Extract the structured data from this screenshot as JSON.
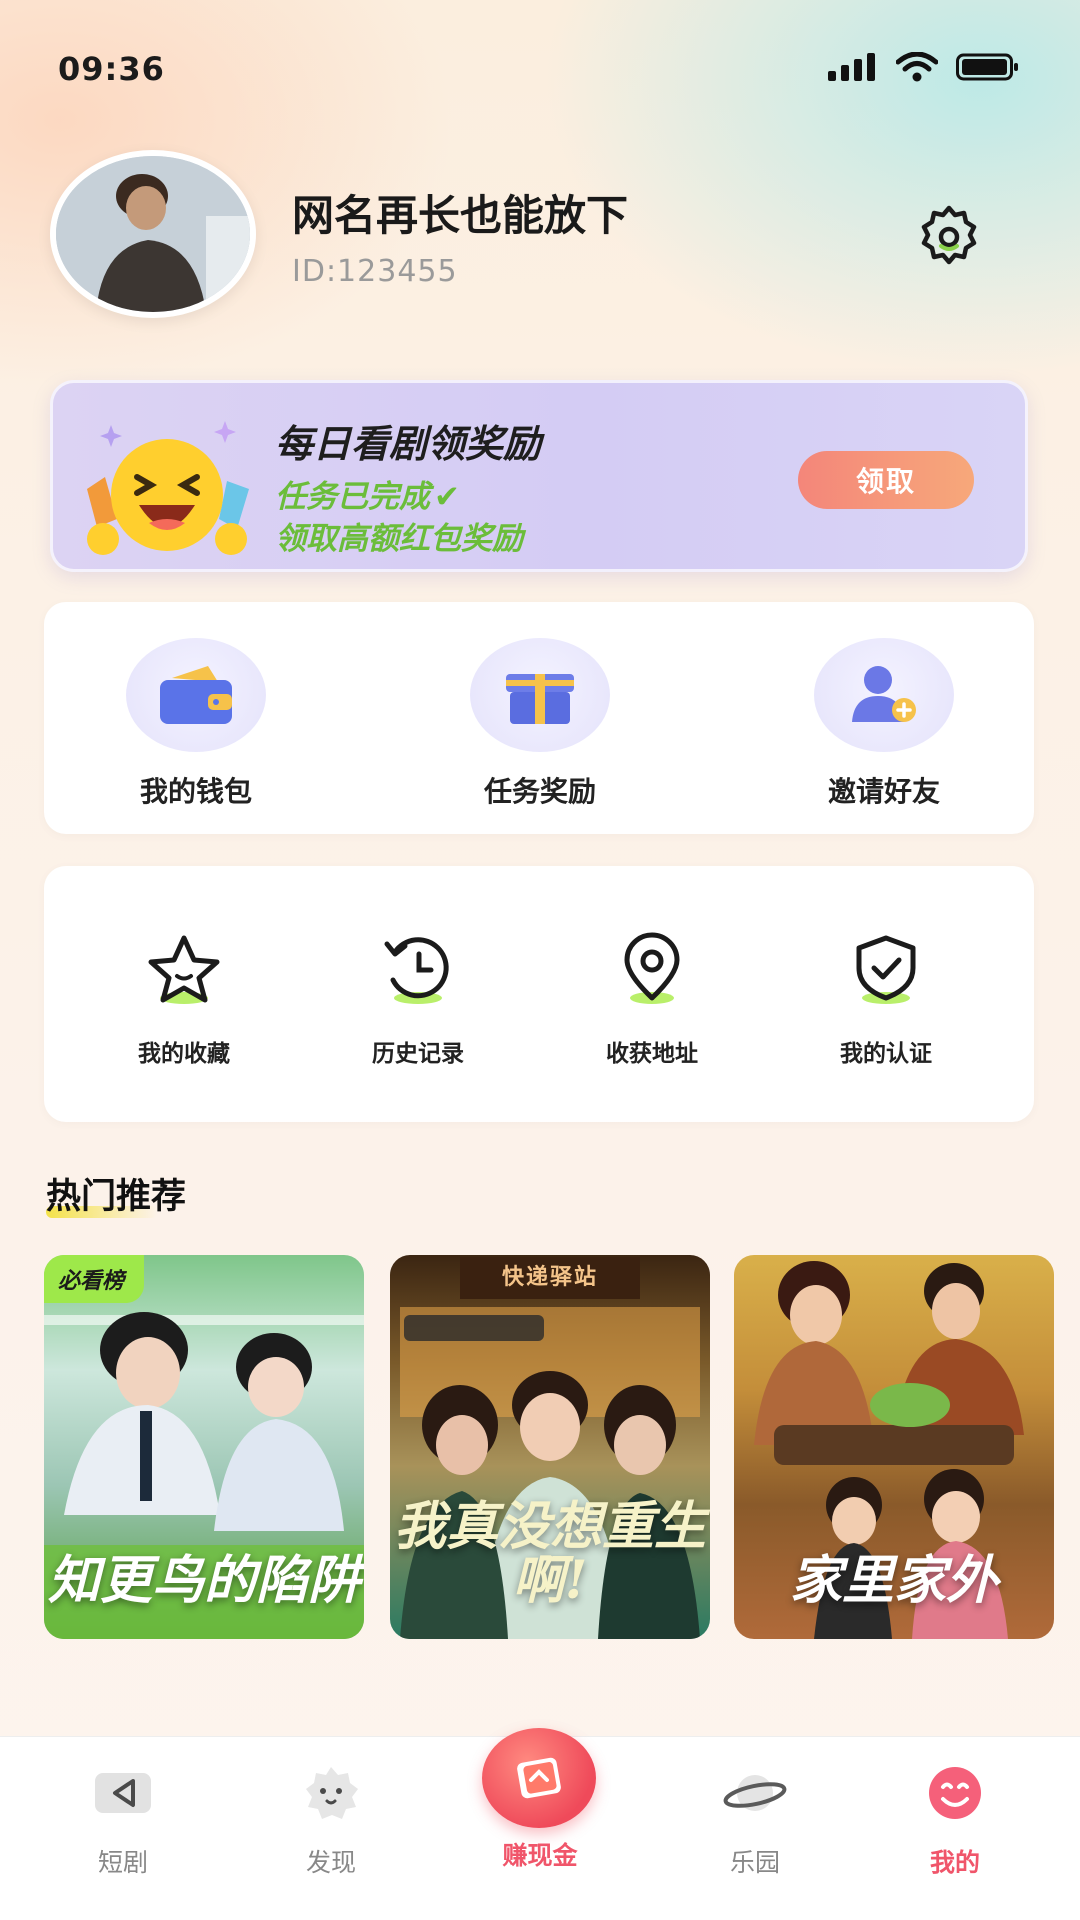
{
  "status": {
    "time": "09:36"
  },
  "profile": {
    "username": "网名再长也能放下",
    "id": "ID:123455"
  },
  "reward": {
    "title": "每日看剧领奖励",
    "status": "任务已完成",
    "subtitle": "领取高额红包奖励",
    "claim_label": "领取"
  },
  "quick_actions": [
    {
      "label": "我的钱包",
      "icon": "wallet-icon"
    },
    {
      "label": "任务奖励",
      "icon": "gift-icon"
    },
    {
      "label": "邀请好友",
      "icon": "add-friend-icon"
    }
  ],
  "tools": [
    {
      "label": "我的收藏",
      "icon": "star-icon"
    },
    {
      "label": "历史记录",
      "icon": "history-icon"
    },
    {
      "label": "收获地址",
      "icon": "location-icon"
    },
    {
      "label": "我的认证",
      "icon": "shield-check-icon"
    }
  ],
  "hot": {
    "title": "热门推荐",
    "items": [
      {
        "title": "知更鸟的陷阱",
        "badge": "必看榜"
      },
      {
        "title": "我真没想重生啊!",
        "sign": "快递驿站"
      },
      {
        "title": "家里家外"
      }
    ]
  },
  "nav": [
    {
      "label": "短剧",
      "icon": "play-tv-icon"
    },
    {
      "label": "发现",
      "icon": "discover-icon"
    },
    {
      "label": "赚现金",
      "icon": "cash-icon"
    },
    {
      "label": "乐园",
      "icon": "planet-icon"
    },
    {
      "label": "我的",
      "icon": "smile-icon"
    }
  ],
  "colors": {
    "accent": "#f0556a",
    "green": "#6bbd3a",
    "purple": "#7b7ee8"
  }
}
